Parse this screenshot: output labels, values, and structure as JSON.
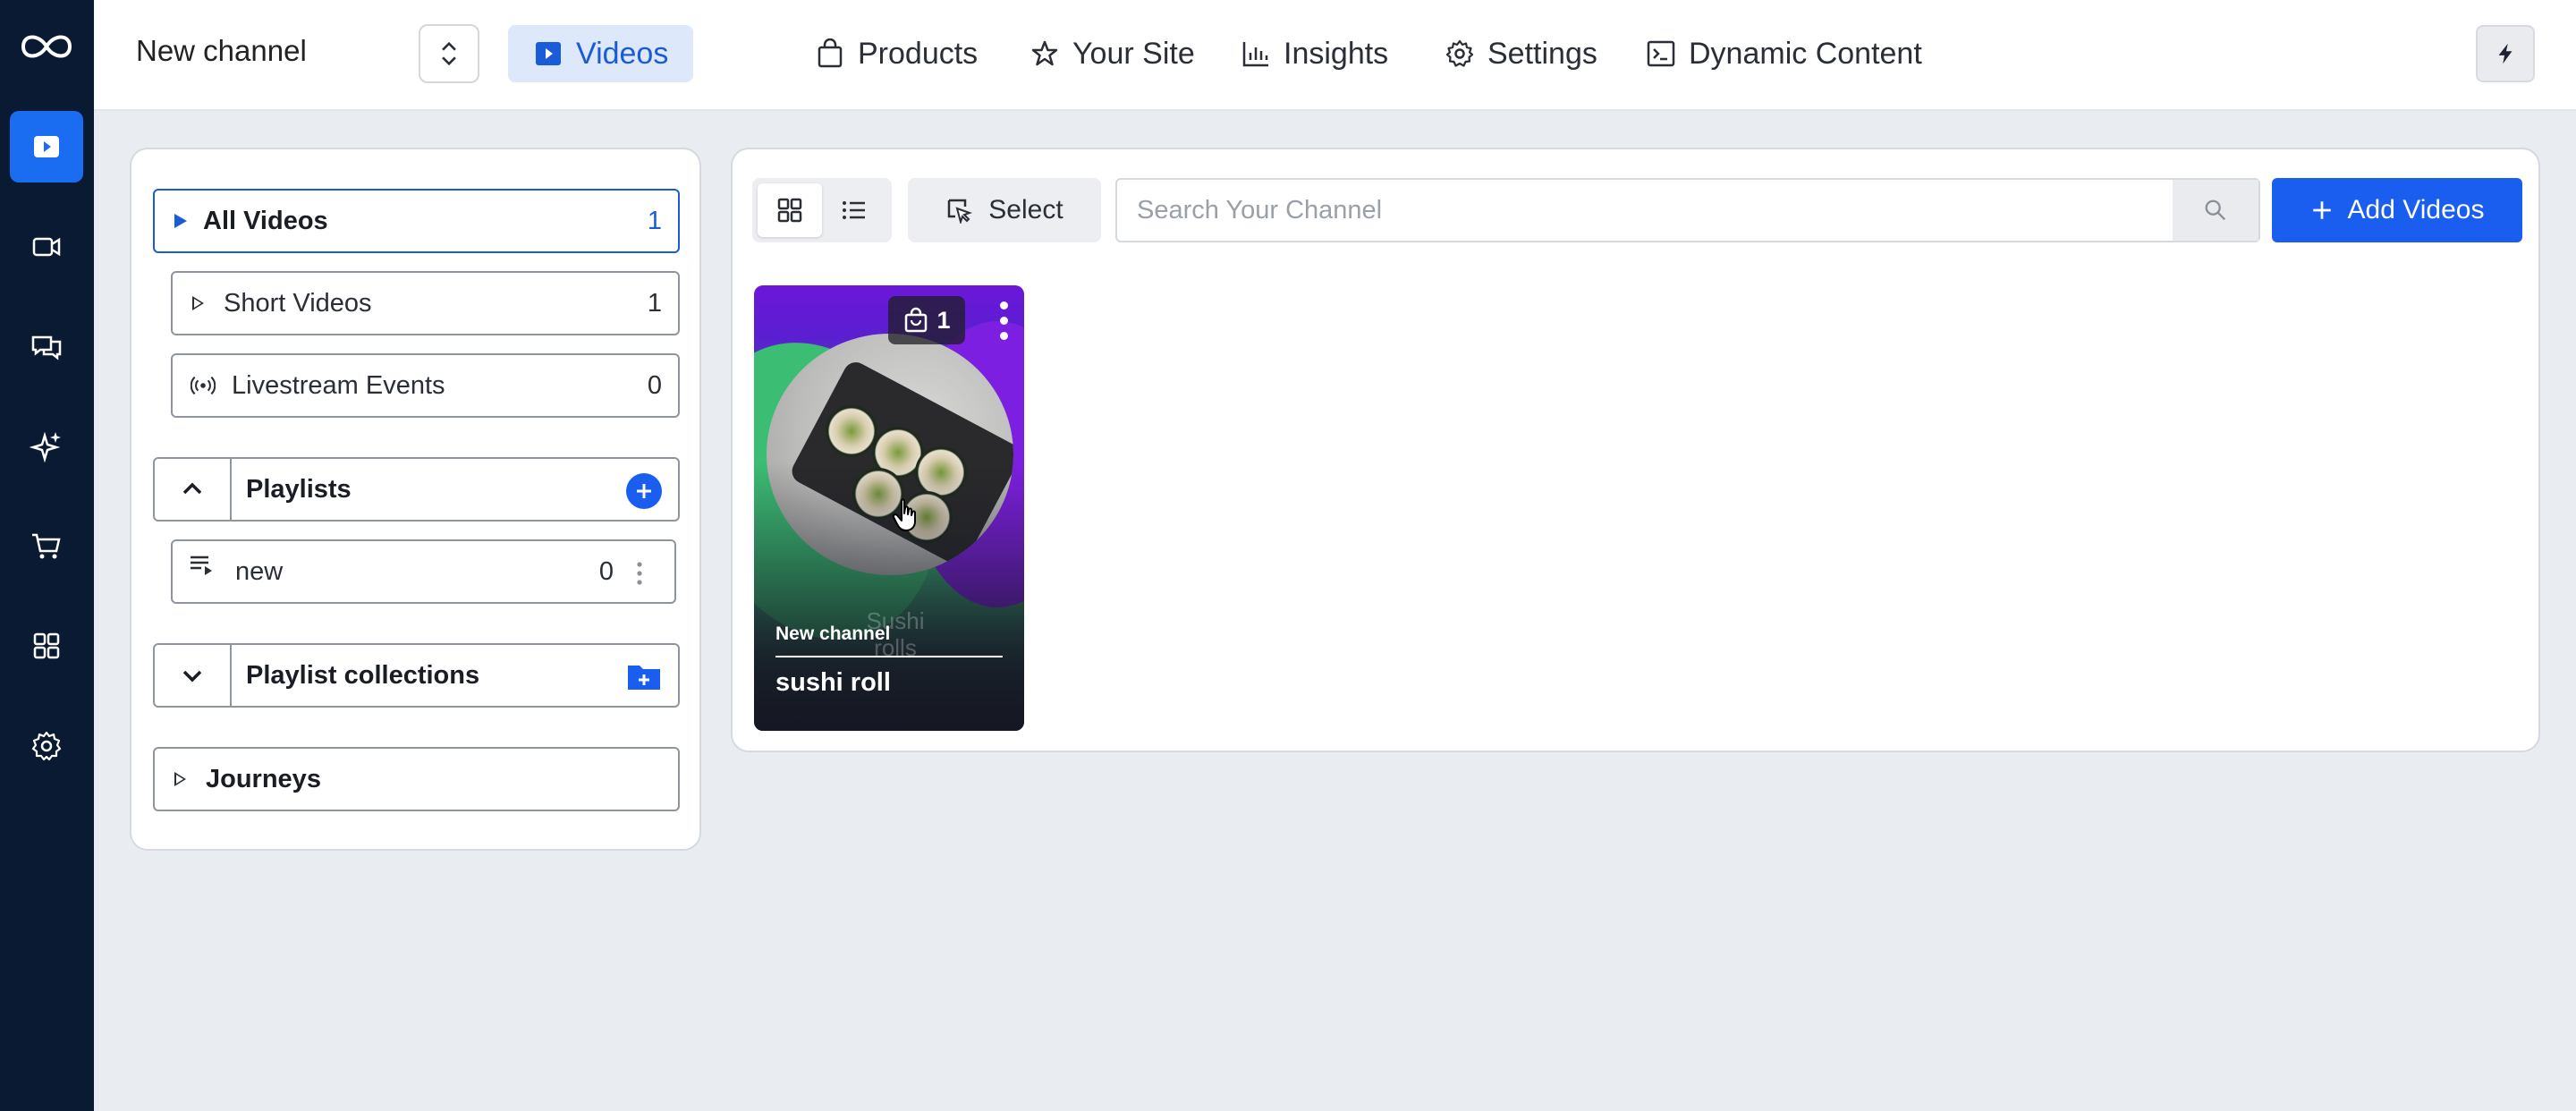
{
  "rail": {
    "items": [
      "logo",
      "videos",
      "video-camera",
      "chat",
      "sparkle",
      "cart",
      "apps",
      "settings"
    ],
    "active": "videos",
    "accent": "#1a6df0",
    "bg": "#0b1a33"
  },
  "header": {
    "channel_name": "New channel",
    "tabs": [
      {
        "label": "Videos",
        "icon": "play-square-icon",
        "active": true
      },
      {
        "label": "Products",
        "icon": "bag-icon"
      },
      {
        "label": "Your Site",
        "icon": "star-icon"
      },
      {
        "label": "Insights",
        "icon": "bar-chart-icon"
      },
      {
        "label": "Settings",
        "icon": "gear-icon"
      },
      {
        "label": "Dynamic Content",
        "icon": "terminal-icon"
      }
    ]
  },
  "library": {
    "all_videos": {
      "label": "All Videos",
      "count": "1"
    },
    "short_videos": {
      "label": "Short Videos",
      "count": "1"
    },
    "livestream": {
      "label": "Livestream Events",
      "count": "0"
    },
    "playlists": {
      "label": "Playlists"
    },
    "playlist_items": [
      {
        "label": "new",
        "count": "0"
      }
    ],
    "playlist_collections": {
      "label": "Playlist collections"
    },
    "journeys": {
      "label": "Journeys"
    }
  },
  "toolbar": {
    "select_label": "Select",
    "search_placeholder": "Search Your Channel",
    "add_label": "Add Videos"
  },
  "videos": [
    {
      "channel": "New channel",
      "title": "sushi roll",
      "products_count": "1",
      "overlay_text": "Sushi rolls"
    }
  ]
}
